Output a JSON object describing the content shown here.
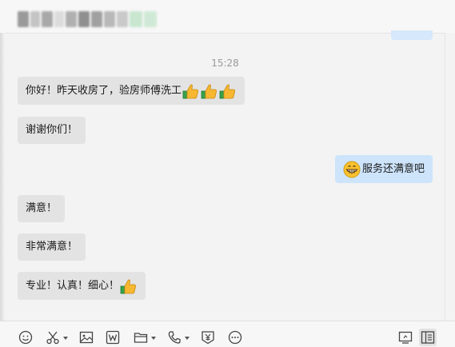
{
  "header": {
    "title_obscured": true
  },
  "chat": {
    "timestamp": "15:28",
    "messages": [
      {
        "side": "left",
        "text": "你好！昨天收房了，验房师傅洗工",
        "emoji": [
          "thumbs-up",
          "thumbs-up",
          "thumbs-up"
        ]
      },
      {
        "side": "left",
        "text": "谢谢你们！",
        "emoji": []
      },
      {
        "side": "right",
        "text": "服务还满意吧",
        "emoji": [
          "grinning-face"
        ]
      },
      {
        "side": "left",
        "text": "满意！",
        "emoji": []
      },
      {
        "side": "left",
        "text": "非常满意！",
        "emoji": []
      },
      {
        "side": "left",
        "text": "专业！认真！细心！",
        "emoji": [
          "thumbs-up"
        ]
      }
    ]
  },
  "toolbar": {
    "icons": [
      "emoji-icon",
      "scissors-icon",
      "image-icon",
      "word-doc-icon",
      "folder-icon",
      "phone-icon",
      "transfer-money-icon",
      "chat-bubble-icon",
      "screen-share-icon",
      "history-icon"
    ]
  },
  "colors": {
    "background": "#f3f3f3",
    "bubble_other": "#e3e3e3",
    "bubble_self": "#cde4fb",
    "timestamp": "#9a9a9a"
  }
}
